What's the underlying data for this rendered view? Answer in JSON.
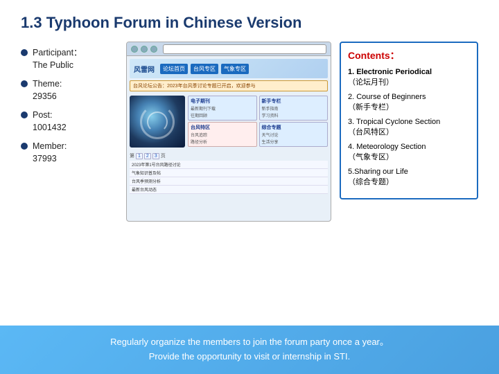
{
  "slide": {
    "title": "1.3 Typhoon Forum in Chinese Version",
    "bullets": [
      {
        "label": "Participant：",
        "value": "The Public"
      },
      {
        "label": "Theme:",
        "value": "29356"
      },
      {
        "label": "Post:",
        "value": "1001432"
      },
      {
        "label": "Member:",
        "value": "37993"
      }
    ],
    "browser": {
      "site_title": "风雷网",
      "nav_items": [
        "论坛首页",
        "台风专区",
        "气象专区"
      ],
      "forum_blocks": [
        {
          "title": "电子期刊 (论坛月刊)",
          "lines": [
            "最新期刊下载",
            "往期回顾"
          ]
        },
        {
          "title": "新手专栏",
          "lines": [
            "新手指南",
            "学习资料"
          ]
        },
        {
          "title": "台风特区",
          "lines": [
            "台风追踪",
            "路径分析"
          ]
        },
        {
          "title": "综合专题",
          "lines": [
            "天气讨论",
            "生活分享"
          ]
        }
      ],
      "forum_rows": [
        "2023年第1号台风路径讨论",
        "气象知识普及帖",
        "台风季预测分析"
      ]
    },
    "contents": {
      "title": "Contents：",
      "items": [
        {
          "num": "1.",
          "en": "Electronic Periodical",
          "cn": "（论坛月刊）"
        },
        {
          "num": "2.",
          "en": "Course of Beginners",
          "cn": "（新手专栏）"
        },
        {
          "num": "3.",
          "en": "Tropical Cyclone Section",
          "cn": "（台风特区）"
        },
        {
          "num": "4.",
          "en": "Meteorology Section",
          "cn": "（气象专区）"
        },
        {
          "num": "5.",
          "en": "Sharing our Life",
          "cn": "（综合专题）"
        }
      ]
    },
    "footer": {
      "line1": "Regularly organize the members to join the forum party once a year。",
      "line2": "Provide the opportunity to visit or internship in STI."
    }
  }
}
